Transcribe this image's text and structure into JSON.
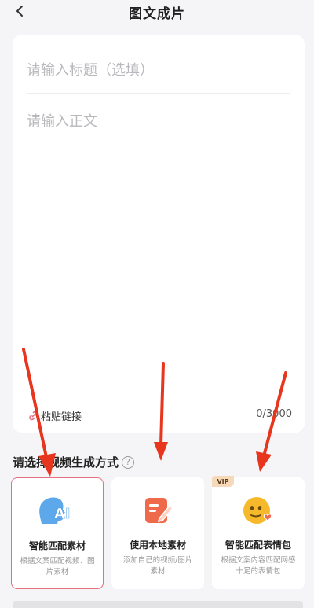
{
  "header": {
    "title": "图文成片"
  },
  "editor": {
    "title_placeholder": "请输入标题（选填）",
    "body_placeholder": "请输入正文",
    "paste_link_label": "粘贴链接",
    "char_count": "0/3000"
  },
  "section": {
    "title": "请选择视频生成方式"
  },
  "options": [
    {
      "title": "智能匹配素材",
      "desc": "根据文案匹配视频、图片素材",
      "icon": "ai-head-icon",
      "selected": true
    },
    {
      "title": "使用本地素材",
      "desc": "添加自己的视频/图片素材",
      "icon": "edit-note-icon",
      "selected": false
    },
    {
      "title": "智能匹配表情包",
      "desc": "根据文案内容匹配网感十足的表情包",
      "icon": "emoji-face-icon",
      "badge": "VIP",
      "selected": false
    }
  ],
  "colors": {
    "accent": "#e66f7f",
    "arrow": "#e8361e",
    "ai_icon": "#4a9fe8",
    "edit_icon": "#ef6a4a",
    "emoji_icon": "#f6b92b"
  }
}
